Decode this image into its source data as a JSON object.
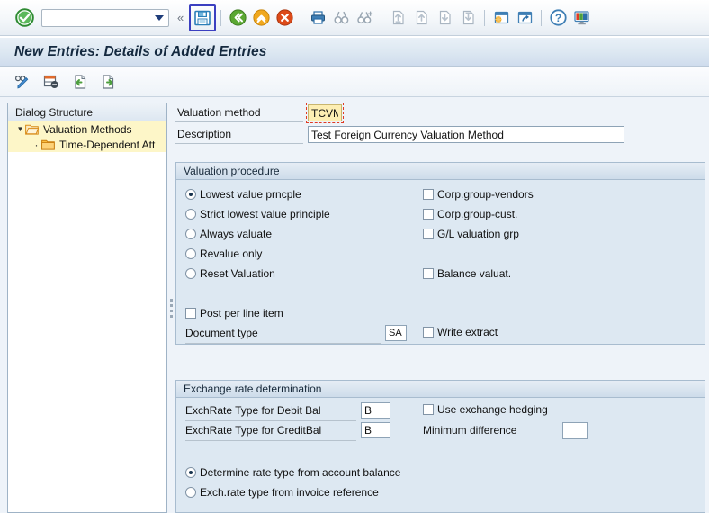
{
  "toolbar": {
    "ok_icon": "green-check-enter-icon",
    "command_field": {
      "value": "",
      "placeholder": ""
    },
    "dropdown_icon": "chevron-down-icon",
    "collapse_icon": "double-chevron-left-icon",
    "buttons": [
      {
        "name": "save-button",
        "icon": "floppy-save-icon",
        "focused": true
      },
      {
        "name": "back-button",
        "icon": "green-back-arrow-icon",
        "focused": false
      },
      {
        "name": "exit-button",
        "icon": "yellow-exit-up-icon",
        "focused": false
      },
      {
        "name": "cancel-button",
        "icon": "red-cancel-x-icon",
        "focused": false
      },
      {
        "name": "print-button",
        "icon": "printer-icon",
        "focused": false
      },
      {
        "name": "find-button",
        "icon": "binoculars-find-icon",
        "focused": false
      },
      {
        "name": "find-next-button",
        "icon": "binoculars-plus-find-next-icon",
        "focused": false
      },
      {
        "name": "first-page-button",
        "icon": "first-page-icon",
        "focused": false
      },
      {
        "name": "previous-page-button",
        "icon": "previous-page-icon",
        "focused": false
      },
      {
        "name": "next-page-button",
        "icon": "next-page-icon",
        "focused": false
      },
      {
        "name": "last-page-button",
        "icon": "last-page-icon",
        "focused": false
      },
      {
        "name": "create-session-button",
        "icon": "new-session-icon",
        "focused": false
      },
      {
        "name": "create-shortcut-button",
        "icon": "shortcut-icon",
        "focused": false
      },
      {
        "name": "help-button",
        "icon": "question-help-icon",
        "focused": false
      },
      {
        "name": "customize-layout-button",
        "icon": "local-layout-monitor-icon",
        "focused": false
      }
    ]
  },
  "title": "New Entries: Details of Added Entries",
  "app_toolbar": {
    "buttons": [
      {
        "name": "display-change-button",
        "icon": "glasses-pencil-icon"
      },
      {
        "name": "delete-entry-button",
        "icon": "delete-row-icon"
      },
      {
        "name": "previous-entry-button",
        "icon": "page-previous-green-left-icon"
      },
      {
        "name": "next-entry-button",
        "icon": "page-next-green-right-icon"
      }
    ]
  },
  "tree": {
    "header": "Dialog Structure",
    "items": [
      {
        "label": "Valuation Methods",
        "level": 1,
        "selected": true,
        "expanded": true,
        "icon": "open-folder-icon"
      },
      {
        "label": "Time-Dependent Att",
        "level": 2,
        "selected": true,
        "expanded": false,
        "icon": "closed-folder-icon"
      }
    ]
  },
  "form": {
    "valuation_method": {
      "label": "Valuation method",
      "value": "TCVM",
      "required": true,
      "focused": true
    },
    "description": {
      "label": "Description",
      "value": "Test Foreign Currency Valuation Method"
    }
  },
  "valuation_procedure": {
    "title": "Valuation procedure",
    "radios": [
      {
        "label": "Lowest value prncple",
        "checked": true
      },
      {
        "label": "Strict lowest value principle",
        "checked": false
      },
      {
        "label": "Always valuate",
        "checked": false
      },
      {
        "label": "Revalue only",
        "checked": false
      },
      {
        "label": "Reset Valuation",
        "checked": false
      }
    ],
    "right_checkboxes": [
      {
        "label": "Corp.group-vendors",
        "checked": false
      },
      {
        "label": "Corp.group-cust.",
        "checked": false
      },
      {
        "label": "G/L valuation grp",
        "checked": false
      },
      {
        "label": "Balance valuat.",
        "checked": false
      },
      {
        "label": "Write extract",
        "checked": false
      }
    ],
    "post_per_line_item": {
      "label": "Post per line item",
      "checked": false
    },
    "document_type": {
      "label": "Document type",
      "value": "SA"
    }
  },
  "exchange_rate": {
    "title": "Exchange rate determination",
    "debit": {
      "label": "ExchRate Type for Debit Bal",
      "value": "B"
    },
    "credit": {
      "label": "ExchRate Type for CreditBal",
      "value": "B"
    },
    "use_exchange_hedging": {
      "label": "Use exchange hedging",
      "checked": false
    },
    "minimum_difference": {
      "label": "Minimum difference",
      "value": ""
    },
    "radios": [
      {
        "label": "Determine rate type from account balance",
        "checked": true
      },
      {
        "label": "Exch.rate type from invoice reference",
        "checked": false
      }
    ]
  },
  "colors": {
    "required_field": "#fdeeb3",
    "focus_ring": "#e03b24",
    "tree_selection": "#fdf6c8",
    "group_background": "#dde8f2",
    "body_background": "#eef3f9",
    "focus_button_border": "#3b3fc0"
  }
}
